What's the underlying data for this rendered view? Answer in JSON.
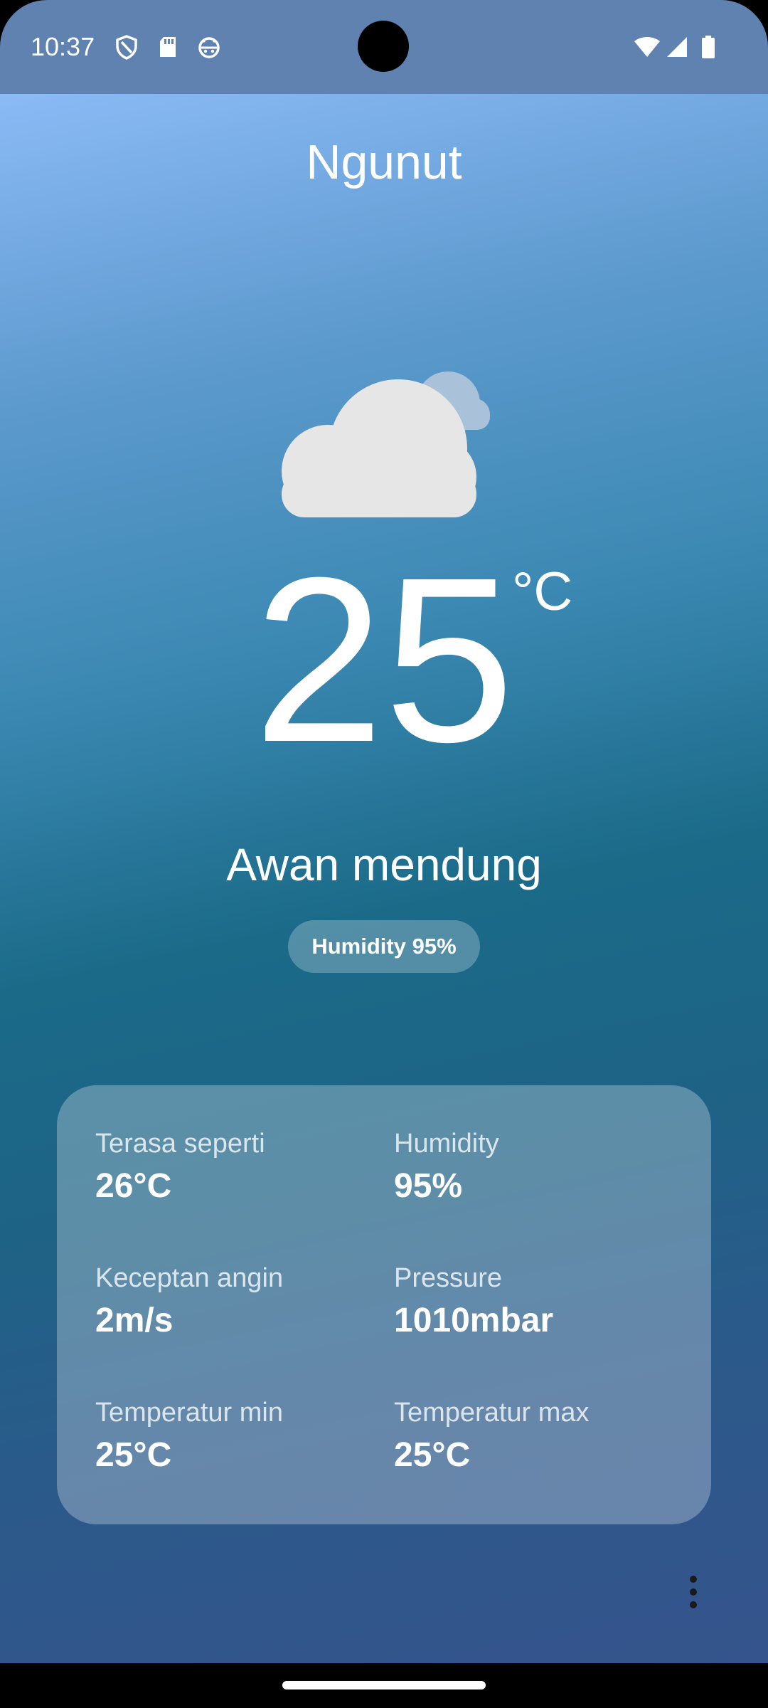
{
  "status_bar": {
    "time": "10:37",
    "left_icons": [
      "shield-icon",
      "sd-card-icon",
      "android-face-icon"
    ],
    "right_icons": [
      "wifi-icon",
      "signal-icon",
      "battery-icon"
    ]
  },
  "location": {
    "city": "Ngunut"
  },
  "current": {
    "icon": "cloud-icon",
    "temperature": "25",
    "unit": "°C",
    "condition": "Awan mendung",
    "humidity_chip": "Humidity 95%"
  },
  "details": {
    "feels_like_label": "Terasa seperti",
    "feels_like_value": "26°C",
    "humidity_label": "Humidity",
    "humidity_value": "95%",
    "wind_label": "Keceptan angin",
    "wind_value": "2m/s",
    "pressure_label": "Pressure",
    "pressure_value": "1010mbar",
    "temp_min_label": "Temperatur min",
    "temp_min_value": "25°C",
    "temp_max_label": "Temperatur max",
    "temp_max_value": "25°C"
  },
  "colors": {
    "status_bar": "#5f82b1",
    "gradient_top": "#8bbaf5",
    "gradient_mid": "#1a6a88",
    "gradient_bottom": "#35538c",
    "cloud_front": "#e6e6e6",
    "cloud_back": "#a9c2d9"
  }
}
